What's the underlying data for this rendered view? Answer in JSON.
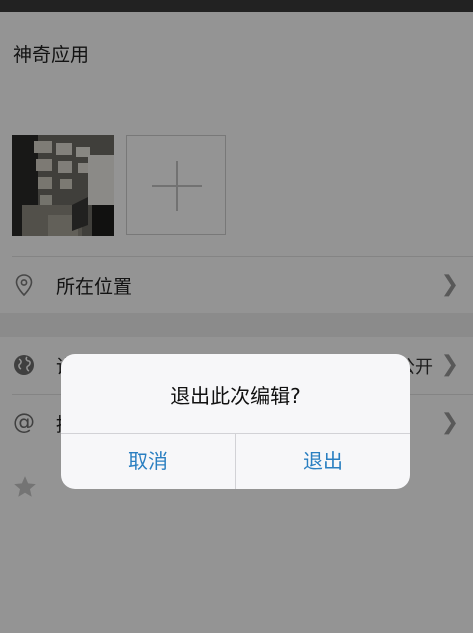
{
  "post": {
    "text": "神奇应用"
  },
  "rows": {
    "location": {
      "label": "所在位置"
    },
    "visibility": {
      "label_partial": "谁",
      "value_partial": "公开"
    },
    "mention": {
      "label_partial": "提"
    }
  },
  "dialog": {
    "title": "退出此次编辑?",
    "cancel_label": "取消",
    "exit_label": "退出"
  },
  "icons": {
    "location": "location-pin-icon",
    "visibility": "globe-icon",
    "mention": "at-sign-icon",
    "favorite": "star-icon",
    "chevron": "chevron-right-icon",
    "add": "plus-icon"
  },
  "colors": {
    "accent": "#2a7fc1",
    "status_bar": "#3b3b3b",
    "dim_overlay": "rgba(0,0,0,0.42)"
  }
}
